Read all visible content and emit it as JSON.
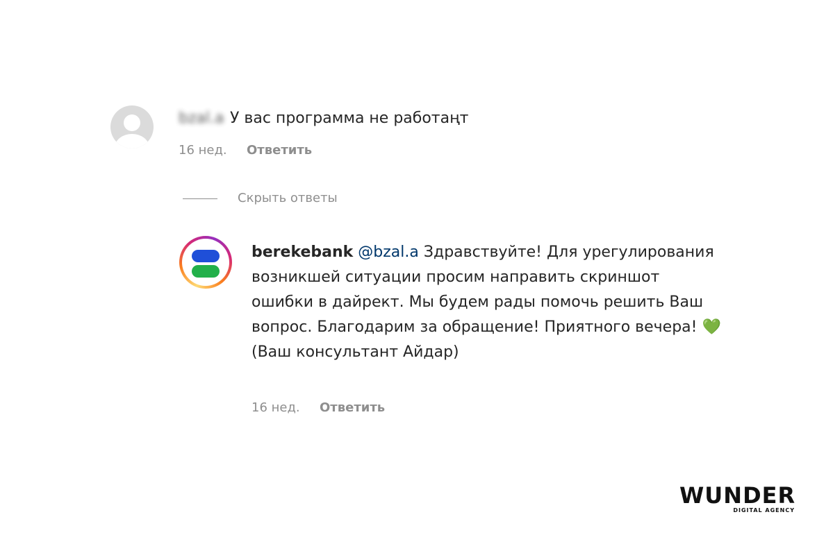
{
  "comment": {
    "username": "bzal.a",
    "text": "У вас программа не работаңт",
    "time": "16 нед.",
    "reply_label": "Ответить"
  },
  "thread": {
    "hide_replies_label": "Скрыть ответы"
  },
  "reply": {
    "username": "berekebank",
    "mention": "@bzal.a",
    "text": "Здравствуйте! Для урегулирования возникшей ситуации просим направить скриншот ошибки в дайрект. Мы будем рады помочь решить Ваш вопрос. Благодарим за обращение! Приятного вечера!",
    "heart": "💚",
    "signature": "(Ваш консультант Айдар)",
    "time": "16 нед.",
    "reply_label": "Ответить",
    "logo_colors": {
      "top": "#1f4fd8",
      "bottom": "#22b04a"
    }
  },
  "watermark": {
    "title": "WUNDER",
    "subtitle": "DIGITAL AGENCY"
  }
}
